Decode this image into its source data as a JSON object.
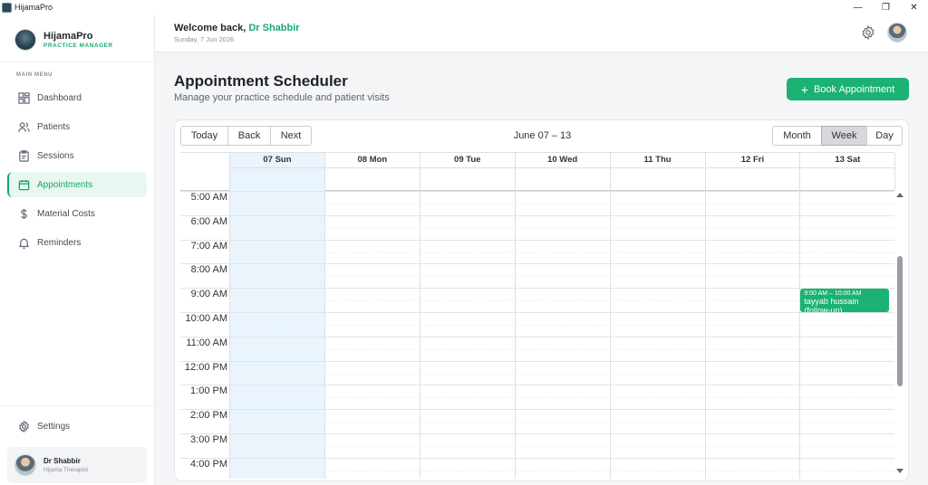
{
  "window": {
    "title": "HijamaPro",
    "minimize": "—",
    "maximize": "❐",
    "close": "✕"
  },
  "brand": {
    "name": "HijamaPro",
    "subtitle": "PRACTICE MANAGER"
  },
  "sidebar": {
    "menu_label": "MAIN MENU",
    "items": [
      {
        "label": "Dashboard",
        "icon": "dashboard-icon"
      },
      {
        "label": "Patients",
        "icon": "users-icon"
      },
      {
        "label": "Sessions",
        "icon": "clipboard-icon"
      },
      {
        "label": "Appointments",
        "icon": "calendar-icon",
        "active": true
      },
      {
        "label": "Material Costs",
        "icon": "dollar-icon"
      },
      {
        "label": "Reminders",
        "icon": "bell-icon"
      }
    ],
    "settings_label": "Settings",
    "user": {
      "name": "Dr Shabbir",
      "role": "Hijama Therapist"
    }
  },
  "header": {
    "welcome_prefix": "Welcome back,",
    "welcome_name": "Dr Shabbir",
    "date": "Sunday, 7 Jun 2026"
  },
  "page": {
    "title": "Appointment Scheduler",
    "subtitle": "Manage your practice schedule and patient visits",
    "book_button": "Book Appointment"
  },
  "calendar": {
    "nav": {
      "today": "Today",
      "back": "Back",
      "next": "Next"
    },
    "range_label": "June 07 – 13",
    "views": {
      "month": "Month",
      "week": "Week",
      "day": "Day",
      "active": "week"
    },
    "days": [
      "07 Sun",
      "08 Mon",
      "09 Tue",
      "10 Wed",
      "11 Thu",
      "12 Fri",
      "13 Sat"
    ],
    "today_index": 0,
    "times": [
      "5:00 AM",
      "6:00 AM",
      "7:00 AM",
      "8:00 AM",
      "9:00 AM",
      "10:00 AM",
      "11:00 AM",
      "12:00 PM",
      "1:00 PM",
      "2:00 PM",
      "3:00 PM",
      "4:00 PM"
    ],
    "events": [
      {
        "day_index": 6,
        "start": "9:00 AM",
        "end": "10:00 AM",
        "time_label": "9:00 AM – 10:00 AM",
        "title": "tayyab hussain (follow-up)"
      }
    ]
  },
  "colors": {
    "accent": "#1bb274",
    "today_bg": "#eaf4fd"
  }
}
